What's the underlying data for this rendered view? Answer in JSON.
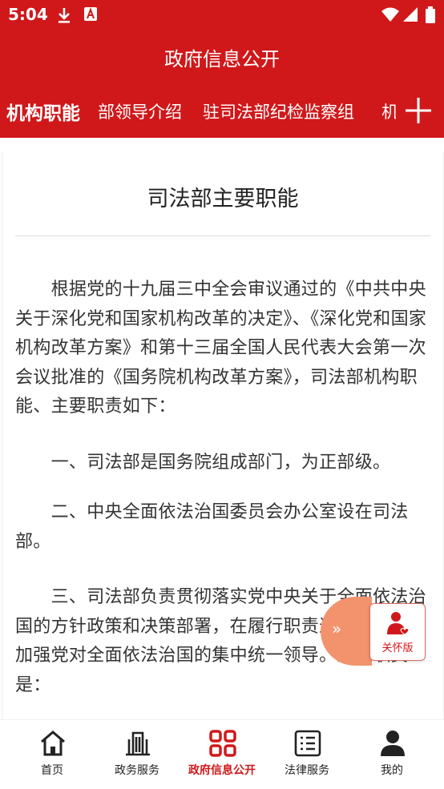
{
  "status_bar": {
    "time": "5:04",
    "icons": [
      "download-icon",
      "notification-a-icon",
      "wifi-icon",
      "signal-icon",
      "battery-icon"
    ]
  },
  "header": {
    "title": "政府信息公开"
  },
  "tabs": [
    {
      "label": "机构职能",
      "active": true
    },
    {
      "label": "部领导介绍",
      "active": false
    },
    {
      "label": "驻司法部纪检监察组",
      "active": false
    },
    {
      "label": "机",
      "active": false
    }
  ],
  "article": {
    "title": "司法部主要职能",
    "paragraphs": [
      "　　根据党的十九届三中全会审议通过的《中共中央关于深化党和国家机构改革的决定》、《深化党和国家机构改革方案》和第十三届全国人民代表大会第一次会议批准的《国务院机构改革方案》，司法部机构职能、主要职责如下：",
      "　　一、司法部是国务院组成部门，为正部级。",
      "　　二、中央全面依法治国委员会办公室设在司法部。",
      "　　三、司法部负责贯彻落实党中央关于全面依法治国的方针政策和决策部署，在履行职责过程中坚持和加强党对全面依法治国的集中统一领导。主要职责是："
    ]
  },
  "floating": {
    "expand_glyph": "»",
    "care_label": "关怀版"
  },
  "bottom_nav": [
    {
      "label": "首页",
      "icon": "home-icon",
      "active": false
    },
    {
      "label": "政务服务",
      "icon": "building-icon",
      "active": false
    },
    {
      "label": "政府信息公开",
      "icon": "grid-icon",
      "active": true
    },
    {
      "label": "法律服务",
      "icon": "list-icon",
      "active": false
    },
    {
      "label": "我的",
      "icon": "person-icon",
      "active": false
    }
  ],
  "colors": {
    "primary": "#d0181a",
    "accent_orange": "#f3936d"
  }
}
